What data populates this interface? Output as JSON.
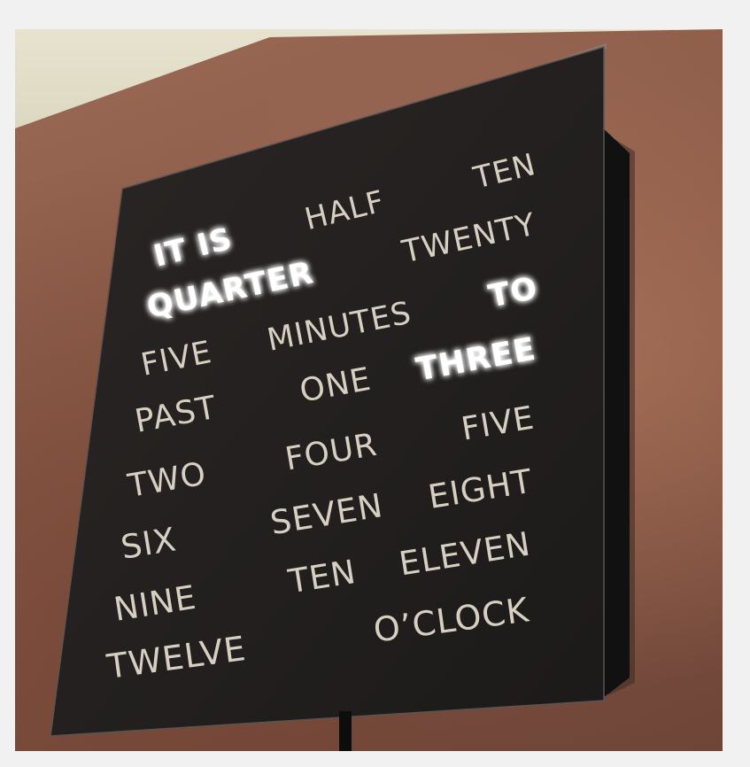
{
  "scene": {
    "description_free": true,
    "wall_color": "#8a5a48",
    "clock_face_color": "#211e1d",
    "unlit_letter_color": "#d7d0c2",
    "lit_letter_color": "#ffffff"
  },
  "clock_rows": [
    {
      "words": [
        {
          "text": "IT IS",
          "lit": true
        },
        {
          "text": "HALF",
          "lit": false
        },
        {
          "text": "TEN",
          "lit": false
        }
      ]
    },
    {
      "words": [
        {
          "text": "QUARTER",
          "lit": true
        },
        {
          "text": "TWENTY",
          "lit": false
        }
      ]
    },
    {
      "words": [
        {
          "text": "FIVE",
          "lit": false
        },
        {
          "text": "MINUTES",
          "lit": false
        },
        {
          "text": "TO",
          "lit": true
        }
      ]
    },
    {
      "words": [
        {
          "text": "PAST",
          "lit": false
        },
        {
          "text": "ONE",
          "lit": false
        },
        {
          "text": "THREE",
          "lit": true
        }
      ]
    },
    {
      "words": [
        {
          "text": "TWO",
          "lit": false
        },
        {
          "text": "FOUR",
          "lit": false
        },
        {
          "text": "FIVE",
          "lit": false
        }
      ]
    },
    {
      "words": [
        {
          "text": "SIX",
          "lit": false
        },
        {
          "text": "SEVEN",
          "lit": false
        },
        {
          "text": "EIGHT",
          "lit": false
        }
      ]
    },
    {
      "words": [
        {
          "text": "NINE",
          "lit": false
        },
        {
          "text": "TEN",
          "lit": false
        },
        {
          "text": "ELEVEN",
          "lit": false
        }
      ]
    },
    {
      "words": [
        {
          "text": "TWELVE",
          "lit": false
        },
        {
          "text": "O’CLOCK",
          "lit": false
        }
      ]
    }
  ]
}
